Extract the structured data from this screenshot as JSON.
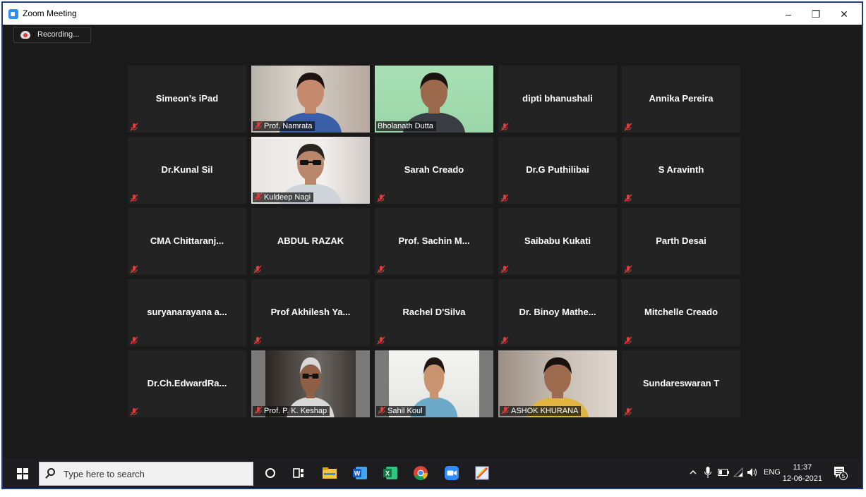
{
  "window": {
    "title": "Zoom Meeting",
    "minimize": "–",
    "restore": "❐",
    "close": "✕"
  },
  "recording": {
    "label": "Recording..."
  },
  "tiles": [
    {
      "name": "Simeon’s iPad",
      "video": false
    },
    {
      "name": "Prof. Namrata",
      "video": true
    },
    {
      "name": "Bholanath Dutta",
      "video": true,
      "active": true
    },
    {
      "name": "dipti bhanushali",
      "video": false
    },
    {
      "name": "Annika Pereira",
      "video": false
    },
    {
      "name": "Dr.Kunal Sil",
      "video": false
    },
    {
      "name": "Kuldeep Nagi",
      "video": true
    },
    {
      "name": "Sarah Creado",
      "video": false
    },
    {
      "name": "Dr.G Puthilibai",
      "video": false
    },
    {
      "name": "S Aravinth",
      "video": false
    },
    {
      "name": "CMA  Chittaranj...",
      "video": false
    },
    {
      "name": "ABDUL RAZAK",
      "video": false
    },
    {
      "name": "Prof.  Sachin  M...",
      "video": false
    },
    {
      "name": "Saibabu Kukati",
      "video": false
    },
    {
      "name": "Parth Desai",
      "video": false
    },
    {
      "name": "suryanarayana  a...",
      "video": false
    },
    {
      "name": "Prof  Akhilesh  Ya...",
      "video": false
    },
    {
      "name": "Rachel D'Silva",
      "video": false
    },
    {
      "name": "Dr.  Binoy  Mathe...",
      "video": false
    },
    {
      "name": "Mitchelle Creado",
      "video": false
    },
    {
      "name": "Dr.Ch.EdwardRa...",
      "video": false
    },
    {
      "name": "Prof. P. K. Keshap",
      "video": true
    },
    {
      "name": "Sahil Koul",
      "video": true
    },
    {
      "name": "ASHOK KHURANA",
      "video": true
    },
    {
      "name": "Sundareswaran T",
      "video": false
    }
  ],
  "taskbar": {
    "search_placeholder": "Type here to search",
    "language": "ENG",
    "time": "11:37",
    "date": "12-06-2021",
    "notifications": "5"
  },
  "colors": {
    "active_speaker": "#c9e86a",
    "muted": "#e23b3b",
    "zoom_blue": "#2d8cff"
  }
}
